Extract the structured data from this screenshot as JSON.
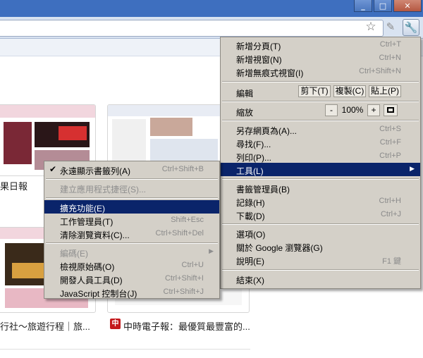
{
  "window": {
    "minimize": "_",
    "restore": "□",
    "close": "✕"
  },
  "toolbar": {
    "bookmark_icon": "star-icon",
    "extension_icon": "puzzle-icon",
    "menu_icon": "wrench-icon"
  },
  "thumbnails": [
    {
      "title": "果日報"
    },
    {
      "title": "行社～旅遊行程｜旅..."
    },
    {
      "title": "中時電子報：最優質最豐富的..."
    }
  ],
  "favicon_text": "中",
  "main_menu": {
    "items": [
      {
        "label": "新增分頁(T)",
        "shortcut": "Ctrl+T"
      },
      {
        "label": "新增視窗(N)",
        "shortcut": "Ctrl+N"
      },
      {
        "label": "新增無痕式視窗(I)",
        "shortcut": "Ctrl+Shift+N"
      },
      {
        "label": "編輯"
      },
      {
        "label": "縮放"
      },
      {
        "label": "另存網頁為(A)...",
        "shortcut": "Ctrl+S"
      },
      {
        "label": "尋找(F)...",
        "shortcut": "Ctrl+F"
      },
      {
        "label": "列印(P)...",
        "shortcut": "Ctrl+P"
      },
      {
        "label": "工具(L)"
      },
      {
        "label": "書籤管理員(B)"
      },
      {
        "label": "記錄(H)",
        "shortcut": "Ctrl+H"
      },
      {
        "label": "下載(D)",
        "shortcut": "Ctrl+J"
      },
      {
        "label": "選項(O)"
      },
      {
        "label": "關於 Google 瀏覽器(G)"
      },
      {
        "label": "說明(E)",
        "shortcut": "F1 鍵"
      },
      {
        "label": "結束(X)"
      }
    ],
    "edit_buttons": {
      "cut": "剪下(T)",
      "copy": "複製(C)",
      "paste": "貼上(P)"
    },
    "zoom": {
      "minus": "-",
      "value": "100%",
      "plus": "+"
    }
  },
  "tools_menu": {
    "items": [
      {
        "label": "永遠顯示書籤列(A)",
        "shortcut": "Ctrl+Shift+B",
        "checked": "✔"
      },
      {
        "label": "建立應用程式捷徑(S)..."
      },
      {
        "label": "擴充功能(E)"
      },
      {
        "label": "工作管理員(T)",
        "shortcut": "Shift+Esc"
      },
      {
        "label": "清除瀏覽資料(C)...",
        "shortcut": "Ctrl+Shift+Del"
      },
      {
        "label": "編碼(E)"
      },
      {
        "label": "檢視原始碼(O)",
        "shortcut": "Ctrl+U"
      },
      {
        "label": "開發人員工具(D)",
        "shortcut": "Ctrl+Shift+I"
      },
      {
        "label": "JavaScript 控制台(J)",
        "shortcut": "Ctrl+Shift+J"
      }
    ]
  },
  "colors": {
    "highlight": "#0a246a",
    "menu_bg": "#d4d0c8",
    "titlebar": "#3e6fbf"
  }
}
